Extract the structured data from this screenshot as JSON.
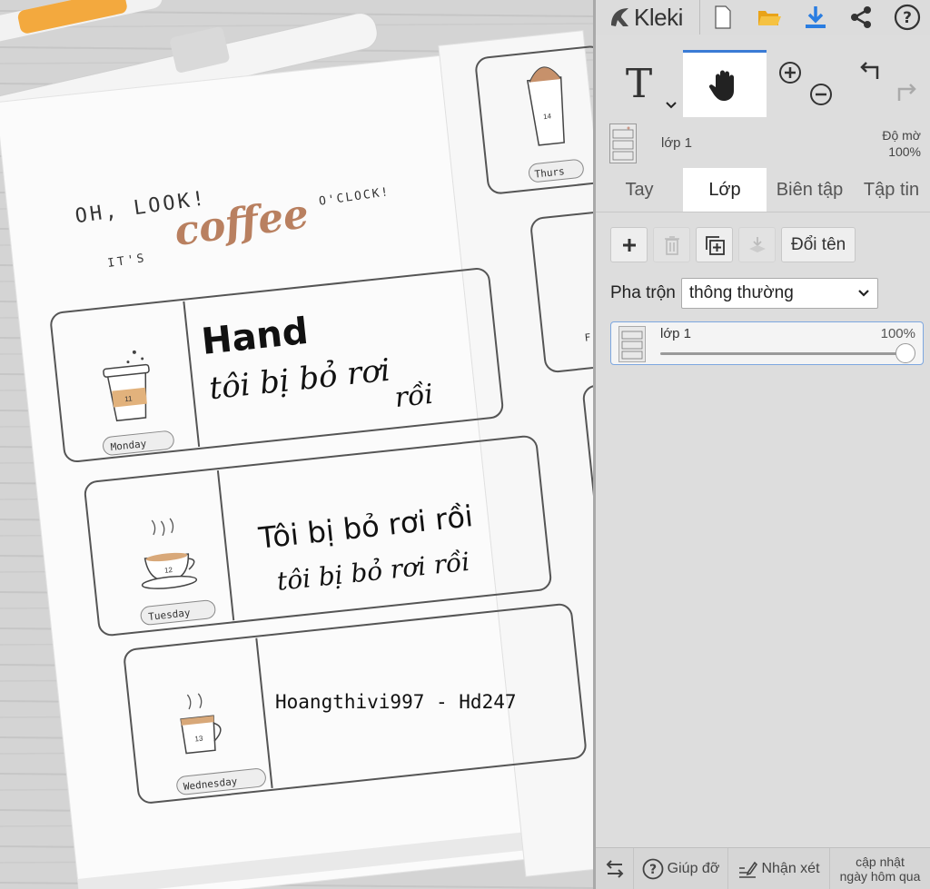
{
  "app": {
    "name": "Kleki"
  },
  "artwork": {
    "header_line1": "OH, LOOK!",
    "header_its": "IT'S",
    "header_coffee": "coffee",
    "header_oclock": "O'CLOCK!",
    "rows": [
      {
        "day": "Monday",
        "cup_number": "11",
        "lines": [
          "Hand",
          "tôi bị bỏ rơi",
          "rồi"
        ]
      },
      {
        "day": "Tuesday",
        "cup_number": "12",
        "lines": [
          "Tôi bị bỏ rơi rồi",
          "tôi bị bỏ rơi rồi"
        ]
      },
      {
        "day": "Wednesday",
        "cup_number": "13",
        "lines": [
          "Hoangthivi997 - Hd247"
        ]
      }
    ],
    "side_day": "Thurs",
    "side_cup_number": "14",
    "side_letter": "F"
  },
  "toolbar": {
    "icons": [
      "new-image-icon",
      "open-folder-icon",
      "download-icon",
      "share-icon",
      "help-icon"
    ],
    "accent_download": "#2a7de1",
    "accent_folder": "#f0b429"
  },
  "tools": {
    "text_glyph": "T",
    "active": "hand"
  },
  "layer_preview": {
    "name": "lớp 1",
    "opacity_label": "Độ mờ",
    "opacity_value": "100%"
  },
  "tabs": [
    {
      "label": "Tay"
    },
    {
      "label": "Lớp",
      "active": true
    },
    {
      "label": "Biên tập"
    },
    {
      "label": "Tập tin"
    }
  ],
  "layers_panel": {
    "rename_label": "Đổi tên",
    "blend_label": "Pha trộn",
    "blend_value": "thông thường",
    "layer": {
      "name": "lớp 1",
      "opacity": "100%",
      "opacity_fraction": 1.0
    }
  },
  "bottom": {
    "help_label": "Giúp đỡ",
    "feedback_label": "Nhận xét",
    "update_line1": "cập nhật",
    "update_line2": "ngày hôm qua"
  }
}
